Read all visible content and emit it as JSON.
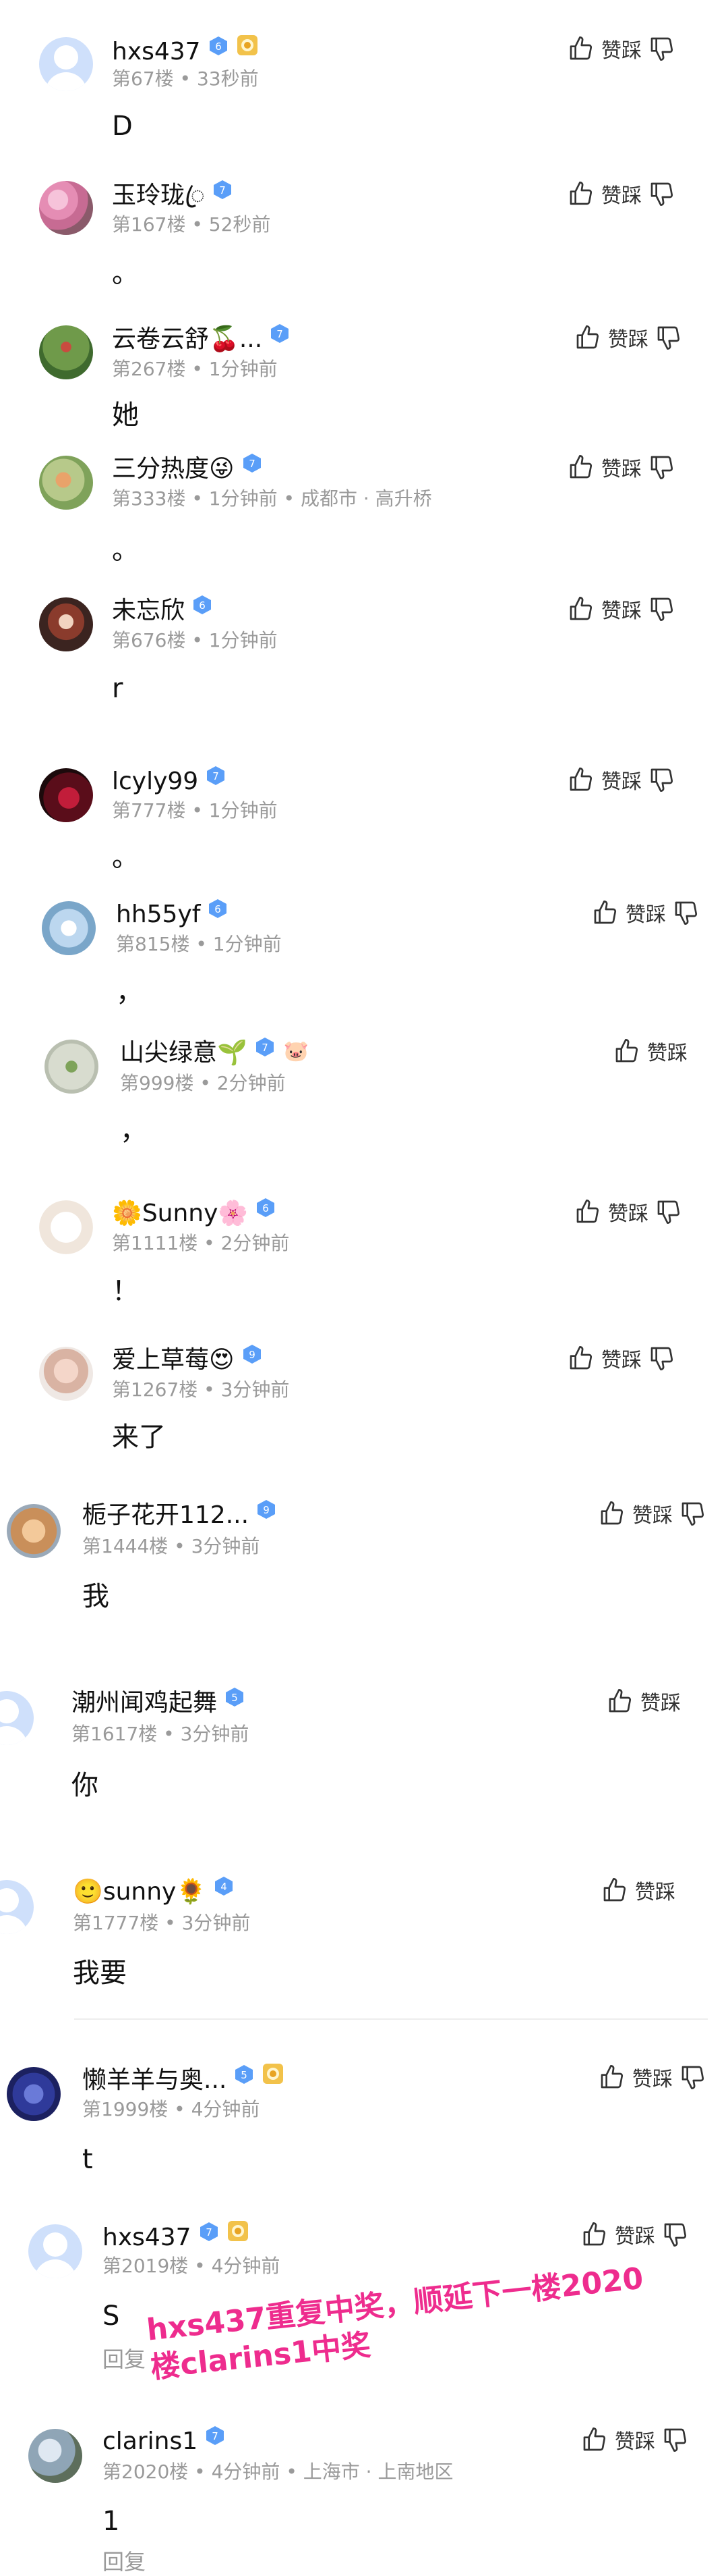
{
  "vote_label": "赞踩",
  "reply_label": "回复",
  "overlay": {
    "line1": "hxs437重复中奖，顺延下一楼2020",
    "line2": "楼clarins1中奖"
  },
  "colors": {
    "accent_overlay": "#ee2c8e",
    "level_badge": "#5a9ef8",
    "meta_text": "#9a9a9a"
  },
  "comments": [
    {
      "user": "hxs437",
      "level": "6",
      "floor": "第67楼",
      "time": "33秒前",
      "text": "D",
      "medal": true,
      "avatar": "default"
    },
    {
      "user": "玉玲珑ꦿ",
      "level": "7",
      "floor": "第167楼",
      "time": "52秒前",
      "text": "。",
      "avatar": "pink-flowers"
    },
    {
      "user": "云卷云舒🍒...",
      "level": "7",
      "floor": "第267楼",
      "time": "1分钟前",
      "text": "她",
      "avatar": "green-garden"
    },
    {
      "user": "三分热度😜",
      "level": "7",
      "floor": "第333楼",
      "time": "1分钟前",
      "location": "成都市 · 高升桥",
      "text": "。",
      "avatar": "fruit-tree"
    },
    {
      "user": "未忘欣",
      "level": "6",
      "floor": "第676楼",
      "time": "1分钟前",
      "text": "r",
      "avatar": "anime-girl"
    },
    {
      "user": "lcyly99",
      "level": "7",
      "floor": "第777楼",
      "time": "1分钟前",
      "text": "。",
      "avatar": "dark-red"
    },
    {
      "user": "hh55yf",
      "level": "6",
      "floor": "第815楼",
      "time": "1分钟前",
      "text": "，",
      "avatar": "snow-flowers"
    },
    {
      "user": "山尖绿意🌱",
      "level": "7",
      "floor": "第999楼",
      "time": "2分钟前",
      "text": "，",
      "extra": "🐷",
      "avatar": "leaf"
    },
    {
      "user": "🌼Sunny🌸",
      "level": "6",
      "floor": "第1111楼",
      "time": "2分钟前",
      "text": "！",
      "avatar": "cartoon-cat"
    },
    {
      "user": "爱上草莓😍",
      "level": "9",
      "floor": "第1267楼",
      "time": "3分钟前",
      "text": "来了",
      "avatar": "baby"
    },
    {
      "user": "栀子花开112...",
      "level": "9",
      "floor": "第1444楼",
      "time": "3分钟前",
      "text": "我",
      "avatar": "bear"
    },
    {
      "user": "潮州闻鸡起舞",
      "level": "5",
      "floor": "第1617楼",
      "time": "3分钟前",
      "text": "你",
      "avatar": "default"
    },
    {
      "user": "🙂sunny🌻",
      "level": "4",
      "floor": "第1777楼",
      "time": "3分钟前",
      "text": "我要",
      "avatar": "default"
    },
    {
      "user": "懒羊羊与奥...",
      "level": "5",
      "floor": "第1999楼",
      "time": "4分钟前",
      "text": "t",
      "medal": true,
      "avatar": "blue-purple"
    },
    {
      "user": "hxs437",
      "level": "7",
      "floor": "第2019楼",
      "time": "4分钟前",
      "text": "S",
      "medal": true,
      "reply": true,
      "avatar": "default"
    },
    {
      "user": "clarins1",
      "level": "7",
      "floor": "第2020楼",
      "time": "4分钟前",
      "location": "上海市 · 上南地区",
      "text": "1",
      "reply": true,
      "avatar": "sky-tree"
    }
  ]
}
